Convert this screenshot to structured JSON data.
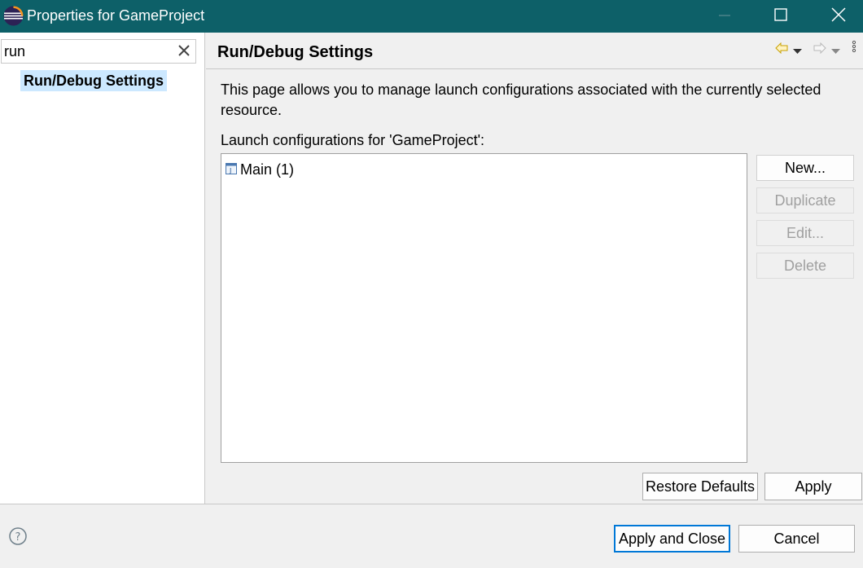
{
  "window": {
    "title": "Properties for GameProject",
    "icons": {
      "app": "eclipse-logo-icon",
      "minimize": "minimize-icon",
      "maximize": "maximize-icon",
      "close": "close-icon"
    }
  },
  "left": {
    "filter_value": "run",
    "filter_clear_icon": "clear-icon",
    "tree": [
      {
        "label": "Run/Debug Settings",
        "selected": true
      }
    ]
  },
  "page": {
    "title": "Run/Debug Settings",
    "nav_icons": [
      "back-arrow-icon",
      "dropdown-icon",
      "forward-arrow-icon",
      "dropdown-icon",
      "view-menu-icon"
    ],
    "description": "This page allows you to manage launch configurations associated with the currently selected resource.",
    "configs_label": "Launch configurations for 'GameProject':",
    "configs": [
      {
        "label": "Main (1)",
        "icon": "java-application-icon"
      }
    ],
    "side_buttons": {
      "new": "New...",
      "duplicate": "Duplicate",
      "edit": "Edit...",
      "delete": "Delete"
    },
    "restore_defaults": "Restore Defaults",
    "apply": "Apply"
  },
  "footer": {
    "help_icon": "help-icon",
    "apply_close": "Apply and Close",
    "cancel": "Cancel"
  },
  "colors": {
    "titlebar": "#0d6068",
    "selection": "#cce8ff",
    "default_button_border": "#0078d7"
  }
}
